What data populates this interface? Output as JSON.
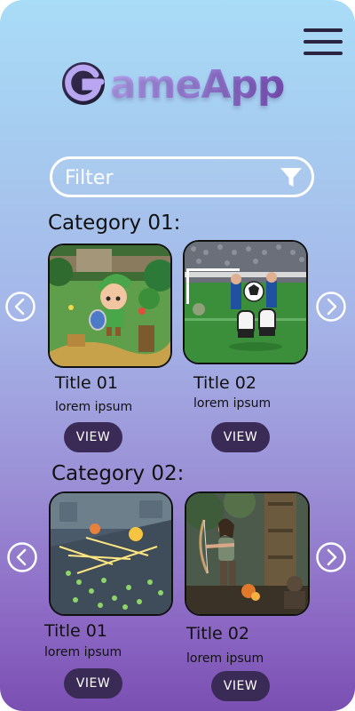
{
  "app": {
    "logo_text": "ameApp",
    "logo_letter": "G"
  },
  "filter": {
    "placeholder": "Filter"
  },
  "categories": [
    {
      "title": "Category 01:",
      "items": [
        {
          "title": "Title 01",
          "description": "lorem ipsum",
          "view_label": "VIEW",
          "image": "fantasy-adventure-art"
        },
        {
          "title": "Title 02",
          "description": "lorem ipsum",
          "view_label": "VIEW",
          "image": "soccer-goalkeeper-art"
        }
      ]
    },
    {
      "title": "Category 02:",
      "items": [
        {
          "title": "Title 01",
          "description": "lorem ipsum",
          "view_label": "VIEW",
          "image": "strategy-battle-art"
        },
        {
          "title": "Title 02",
          "description": "lorem ipsum",
          "view_label": "VIEW",
          "image": "archer-jungle-art"
        }
      ]
    }
  ],
  "icons": {
    "menu": "hamburger-icon",
    "filter": "funnel-icon",
    "prev": "chevron-left-icon",
    "next": "chevron-right-icon"
  },
  "colors": {
    "button_bg": "#3a2a56",
    "menu_bar": "#2a2440",
    "logo_purple": "#9a7fd8"
  }
}
